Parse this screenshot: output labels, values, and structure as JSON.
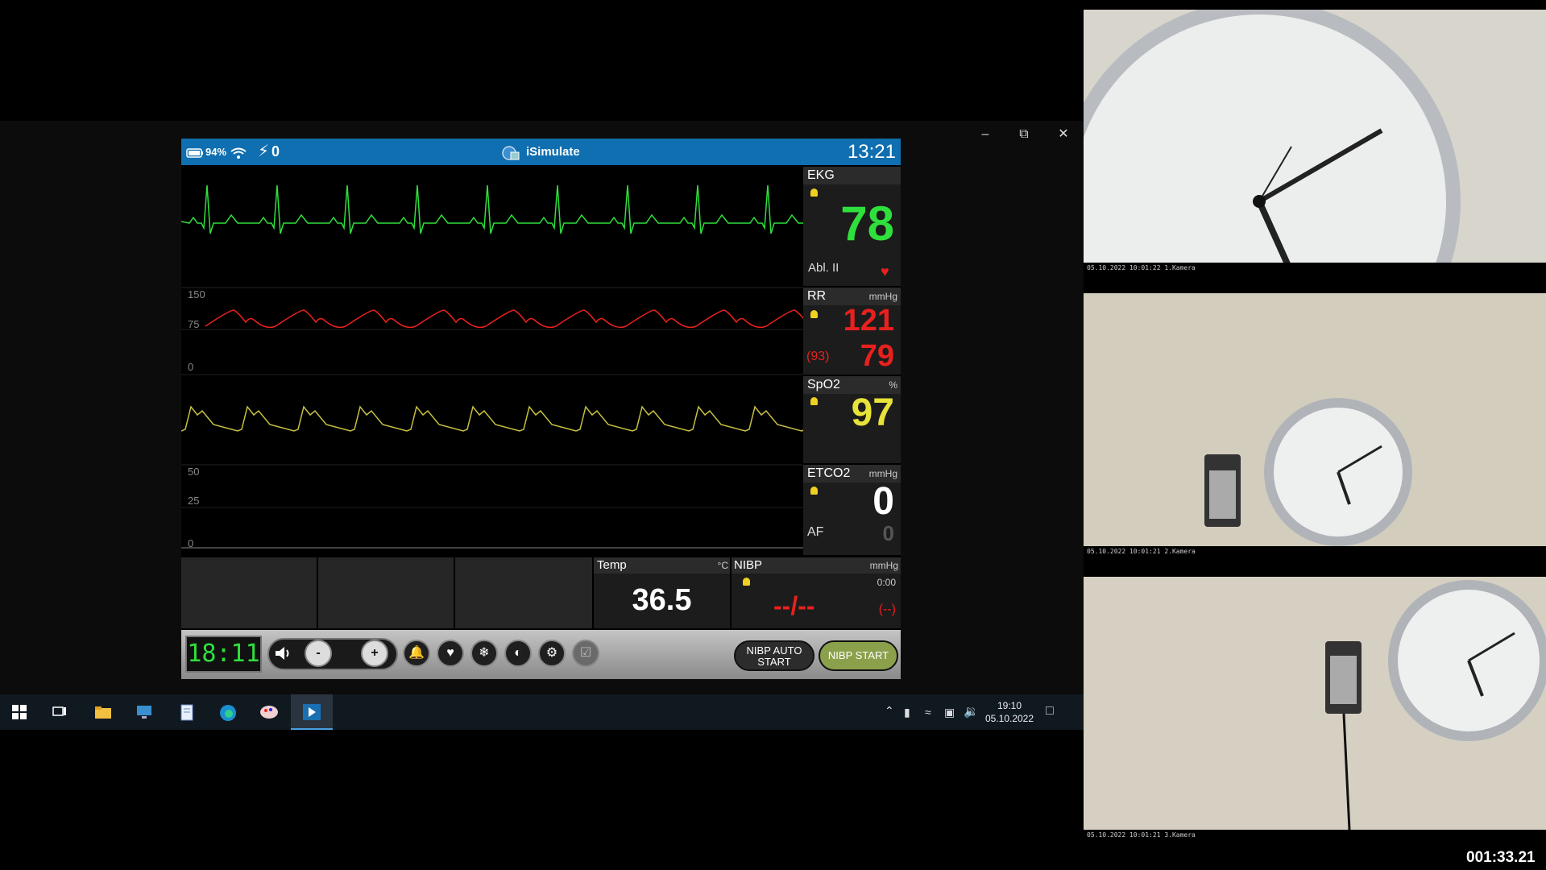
{
  "monitor": {
    "battery": "94%",
    "shock_count": "0",
    "app_title": "iSimulate",
    "time": "13:21",
    "ekg": {
      "label": "EKG",
      "value": "78",
      "lead": "Abl. II"
    },
    "rr": {
      "label": "RR",
      "unit": "mmHg",
      "systolic": "121",
      "mean": "(93)",
      "diastolic": "79"
    },
    "spo2": {
      "label": "SpO2",
      "unit": "%",
      "value": "97"
    },
    "etco2": {
      "label": "ETCO2",
      "unit": "mmHg",
      "value": "0",
      "af_label": "AF",
      "af_value": "0"
    },
    "scale_rr": {
      "top": "150",
      "mid": "75",
      "low": "0"
    },
    "scale_co2": {
      "top": "50",
      "mid": "25",
      "low": "0"
    },
    "temp": {
      "label": "Temp",
      "unit": "°C",
      "value": "36.5"
    },
    "nibp": {
      "label": "NIBP",
      "unit": "mmHg",
      "time": "0:00",
      "value": "--/--",
      "mean": "(--)"
    },
    "timer": "18:11",
    "buttons": {
      "minus": "-",
      "plus": "+",
      "nibp_auto": "NIBP AUTO START",
      "nibp_start": "NIBP START"
    }
  },
  "taskbar": {
    "time": "19:10",
    "date": "05.10.2022"
  },
  "cameras": [
    {
      "label": "05.10.2022 10:01:22 1.Kamera"
    },
    {
      "label": "05.10.2022 10:01:21 2.Kamera"
    },
    {
      "label": "05.10.2022 10:01:21 3.Kamera"
    }
  ],
  "recording_time": "001:33.21",
  "colors": {
    "ekg": "#2fe03c",
    "rr": "#e8211e",
    "spo2": "#e8e23a",
    "statusbar": "#0f6fb0"
  }
}
